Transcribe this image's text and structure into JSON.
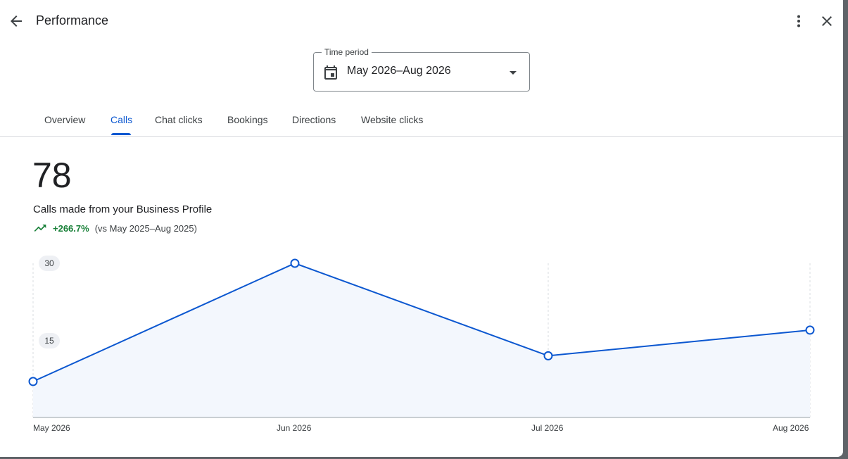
{
  "header": {
    "title": "Performance",
    "icons": {
      "back": "arrow-back-icon",
      "more": "more-vert-icon",
      "close": "close-icon"
    }
  },
  "time_period": {
    "label": "Time period",
    "value": "May 2026–Aug 2026",
    "icon": "calendar-icon"
  },
  "tabs": [
    {
      "label": "Overview",
      "active": false
    },
    {
      "label": "Calls",
      "active": true
    },
    {
      "label": "Chat clicks",
      "active": false
    },
    {
      "label": "Bookings",
      "active": false
    },
    {
      "label": "Directions",
      "active": false
    },
    {
      "label": "Website clicks",
      "active": false
    }
  ],
  "metric": {
    "value": "78",
    "description": "Calls made from your Business Profile",
    "change": "+266.7%",
    "comparison": "(vs May 2025–Aug 2025)"
  },
  "colors": {
    "accent": "#0b57d0",
    "positive": "#188038",
    "area_fill": "#f3f7fd"
  },
  "chart_data": {
    "type": "area",
    "x": [
      "May 2026",
      "Jun 2026",
      "Jul 2026",
      "Aug 2026"
    ],
    "x_days": [
      0,
      31,
      61,
      92
    ],
    "series": [
      {
        "values": [
          7,
          30,
          12,
          17
        ]
      }
    ],
    "y_ticks": [
      "15",
      "30"
    ],
    "ylim": [
      0,
      30
    ]
  }
}
